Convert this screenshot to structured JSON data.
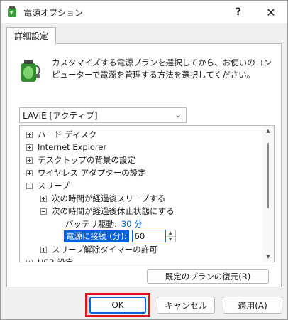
{
  "window": {
    "title": "電源オプション",
    "help_label": "?",
    "close_label": "✕"
  },
  "tab": {
    "label": "詳細設定"
  },
  "description": "カスタマイズする電源プランを選択してから、お使いのコンピューターで電源を管理する方法を選択してください。",
  "plan_select": {
    "value": "LAVIE [アクティブ]"
  },
  "tree": {
    "items": [
      {
        "label": "ハード ディスク"
      },
      {
        "label": "Internet Explorer"
      },
      {
        "label": "デスクトップの背景の設定"
      },
      {
        "label": "ワイヤレス アダプターの設定"
      },
      {
        "label": "スリープ"
      },
      {
        "label": "次の時間が経過後スリープする"
      },
      {
        "label": "次の時間が経過後休止状態にする"
      },
      {
        "label": "バッテリ駆動:",
        "value": "30 分"
      },
      {
        "label": "電源に接続 (分):",
        "value": "60"
      },
      {
        "label": "スリープ解除タイマーの許可"
      },
      {
        "label": "USB 設定"
      }
    ]
  },
  "buttons": {
    "restore": "既定のプランの復元(R)",
    "ok": "OK",
    "cancel": "キャンセル",
    "apply": "適用(A)"
  },
  "colors": {
    "accent": "#0a64d8",
    "highlight": "#e0121f",
    "link": "#0066cc"
  }
}
